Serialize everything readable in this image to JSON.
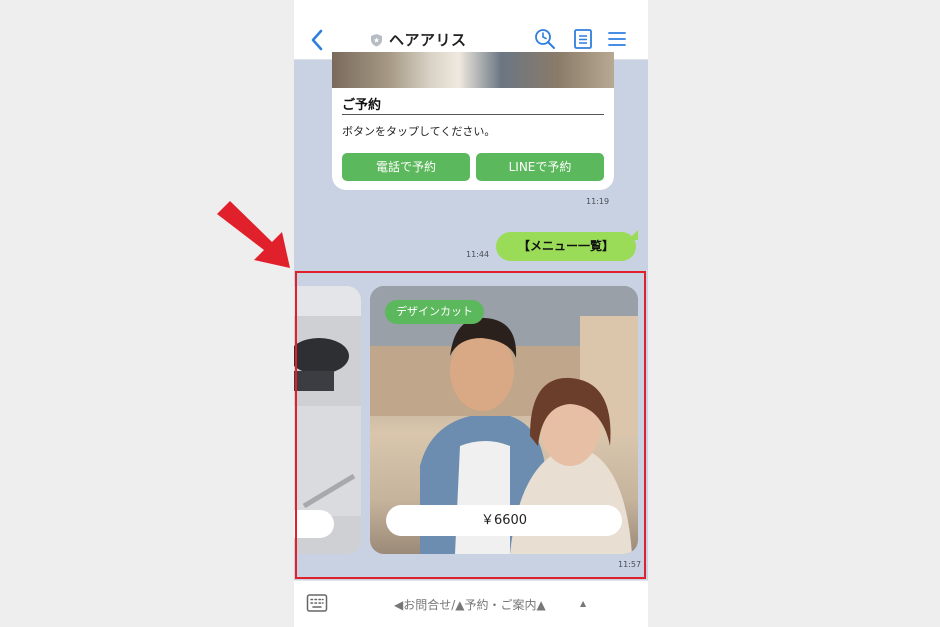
{
  "header": {
    "title": "ヘアアリス",
    "back_icon": "chevron-left-icon",
    "icons": [
      "search-clock-icon",
      "notes-icon",
      "menu-icon"
    ],
    "accent": "#2f7ee0"
  },
  "reservation_card": {
    "title": "ご予約",
    "text": "ボタンをタップしてください。",
    "phone_button": "電話で予約",
    "line_button": "LINEで予約",
    "time": "11:19"
  },
  "user_message": {
    "text": "【メニュー一覧】",
    "time": "11:44"
  },
  "carousel": {
    "tag": "デザインカット",
    "price": "￥6600",
    "time": "11:57",
    "highlight_color": "#e0202b"
  },
  "footer": {
    "keyboard_icon": "keyboard-icon",
    "menu_label": "◀お問合せ/▲予約・ご案内▲",
    "caret": "▲"
  },
  "colors": {
    "chat_bg": "#c9d2e3",
    "button_green": "#5cb85c",
    "bubble_green": "#9adb57",
    "annotation_red": "#e0202b"
  }
}
